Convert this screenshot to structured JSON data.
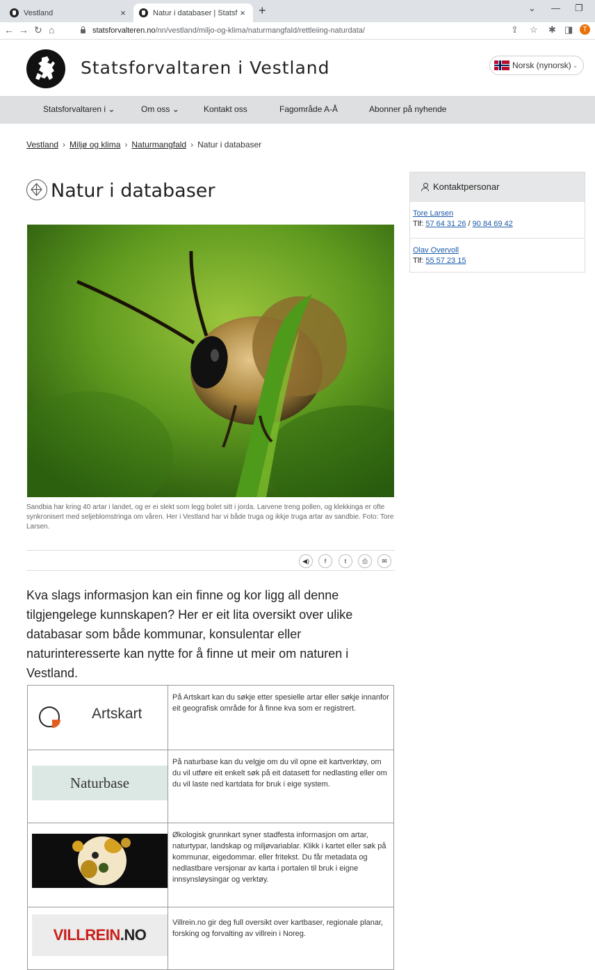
{
  "browser": {
    "tabs": [
      {
        "title": "Vestland",
        "active": false
      },
      {
        "title": "Natur i databaser | Statsforvaltaren",
        "active": true
      }
    ],
    "url_host": "statsforvalteren.no",
    "url_path": "/nn/vestland/miljo-og-klima/naturmangfald/rettleiing-naturdata/",
    "profile_initial": "T"
  },
  "header": {
    "site_title": "Statsforvaltaren i Vestland",
    "language": "Norsk (nynorsk)"
  },
  "nav": {
    "items": [
      {
        "label": "Statsforvaltaren i",
        "has_dropdown": true
      },
      {
        "label": "Om oss",
        "has_dropdown": true
      },
      {
        "label": "Kontakt oss",
        "has_dropdown": false
      },
      {
        "label": "Fagområde A-Å",
        "has_dropdown": false
      },
      {
        "label": "Abonner på nyhende",
        "has_dropdown": false
      }
    ]
  },
  "breadcrumbs": [
    "Vestland",
    "Miljø og klima",
    "Naturmangfald",
    "Natur i databaser"
  ],
  "page": {
    "title": "Natur i databaser",
    "caption": "Sandbia har kring 40 artar i landet, og er ei slekt som legg bolet sitt i jorda. Larvene treng pollen, og klekkinga er ofte synkronisert med seljeblomstringa om våren. Her i Vestland har vi både truga og ikkje truga artar av sandbie. Foto: Tore Larsen.",
    "intro": "Kva slags informasjon kan ein finne og kor ligg all denne tilgjengelege kunnskapen? Her er eit lita oversikt over ulike databasar som både kommunar, konsulentar eller naturinteresserte kan nytte for å finne ut meir om naturen i Vestland."
  },
  "share": {
    "icons": [
      "speaker-icon",
      "facebook-icon",
      "twitter-icon",
      "print-icon",
      "mail-icon"
    ]
  },
  "databases": [
    {
      "name": "Artskart",
      "logo_text": "Artskart",
      "description": "På Artskart kan du søkje etter spesielle artar eller søkje innanfor eit geografisk område for å finne kva som er registrert."
    },
    {
      "name": "Naturbase",
      "logo_text": "Naturbase",
      "description": "På naturbase kan du velgje om du vil opne eit kartverktøy, om du vil utføre eit enkelt søk på eit datasett for nedlasting eller om du vil laste ned kartdata for bruk i eige system."
    },
    {
      "name": "Økologisk grunnkart",
      "logo_text": "",
      "description": "Økologisk grunnkart syner stadfesta informasjon om artar, naturtypar, landskap og miljøvariablar. Klikk i kartet eller søk på kommunar, eigedommar. eller fritekst. Du får metadata og nedlastbare versjonar av karta i portalen til bruk i eigne innsynsløysingar og verktøy."
    },
    {
      "name": "Villrein.no",
      "logo_red": "VILLREIN",
      "logo_dark": ".NO",
      "description": "Villrein.no gir deg full oversikt over kartbaser, regionale planar, forsking og forvalting av villrein i Noreg."
    }
  ],
  "sidebar": {
    "heading": "Kontaktpersonar",
    "contacts": [
      {
        "name": "Tore Larsen",
        "phone_label": "Tlf:",
        "phone1": "57 64 31 26",
        "separator": "/",
        "phone2": "90 84 69 42"
      },
      {
        "name": "Olav Overvoll",
        "phone_label": "Tlf:",
        "phone1": "55 57 23 15"
      }
    ]
  }
}
